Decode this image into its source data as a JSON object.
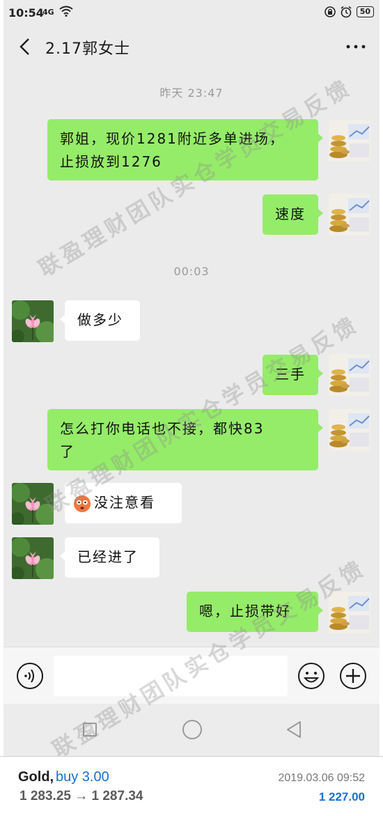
{
  "status_bar": {
    "time": "10:54",
    "network": "4G",
    "battery": "50"
  },
  "header": {
    "title": "2.17郭女士"
  },
  "messages": [
    {
      "type": "timestamp",
      "text": "昨天 23:47"
    },
    {
      "type": "sent",
      "line1": "郭姐，现价1281附近多单进场，",
      "line2": "止损放到1276"
    },
    {
      "type": "sent",
      "text": "速度"
    },
    {
      "type": "timestamp",
      "text": "00:03"
    },
    {
      "type": "received",
      "text": "做多少"
    },
    {
      "type": "sent",
      "text": "三手"
    },
    {
      "type": "sent",
      "line1": "怎么打你电话也不接，都快83",
      "line2": "了"
    },
    {
      "type": "received",
      "text": "没注意看"
    },
    {
      "type": "received",
      "text": "已经进了"
    },
    {
      "type": "sent",
      "text": "嗯，止损带好"
    }
  ],
  "watermark": {
    "text": "联盈理财团队实仓学员交易反馈"
  },
  "trade": {
    "asset": "Gold,",
    "action": "buy 3.00",
    "prices": "1 283.25 → 1 287.34",
    "datetime": "2019.03.06 09:52",
    "profit": "1 227.00"
  },
  "colors": {
    "sent_bubble": "#95ec69",
    "received_bubble": "#ffffff",
    "chat_bg": "#ebebeb",
    "accent_blue": "#1a6fd0"
  }
}
